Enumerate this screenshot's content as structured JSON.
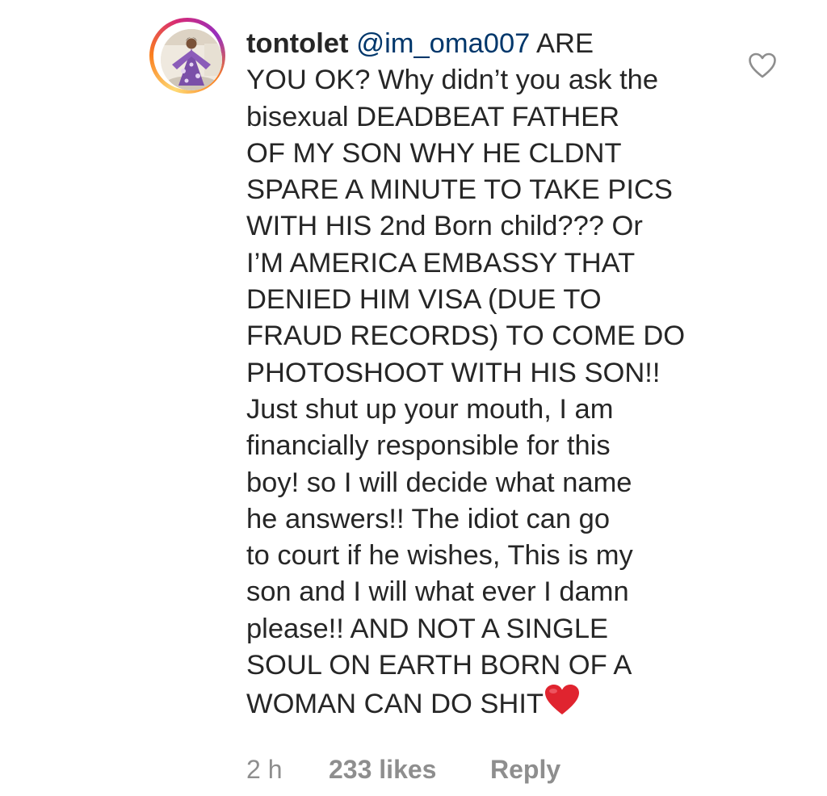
{
  "comment": {
    "username": "tontolet",
    "mention": "@im_oma007",
    "first_line_rest": " ARE",
    "lines": [
      "YOU OK? Why didn’t you ask the",
      "bisexual DEADBEAT FATHER",
      "OF MY SON WHY HE CLDNT",
      "SPARE A MINUTE TO TAKE PICS",
      "WITH HIS 2nd Born child??? Or",
      "I’M AMERICA EMBASSY THAT",
      "DENIED HIM VISA (DUE TO",
      "FRAUD RECORDS) TO COME DO",
      "PHOTOSHOOT WITH HIS SON!!",
      "Just shut up your mouth, I  am",
      "financially responsible for this",
      "boy!  so I will decide what name",
      "he answers!! The idiot can go",
      "to court if he wishes, This is my",
      "son and I will what ever I damn",
      "please!! AND NOT A SINGLE",
      "SOUL ON EARTH BORN OF A"
    ],
    "last_line": "WOMAN CAN DO SHIT",
    "emoji": "red-heart-emoji",
    "avatar_icon": "profile-avatar",
    "like_icon": "heart-outline-icon"
  },
  "meta": {
    "time": "2 h",
    "likes": "233 likes",
    "reply": "Reply"
  },
  "colors": {
    "text": "#262626",
    "mention": "#00376b",
    "meta": "#8e8e8e",
    "heart_emoji": "#e0242f"
  }
}
